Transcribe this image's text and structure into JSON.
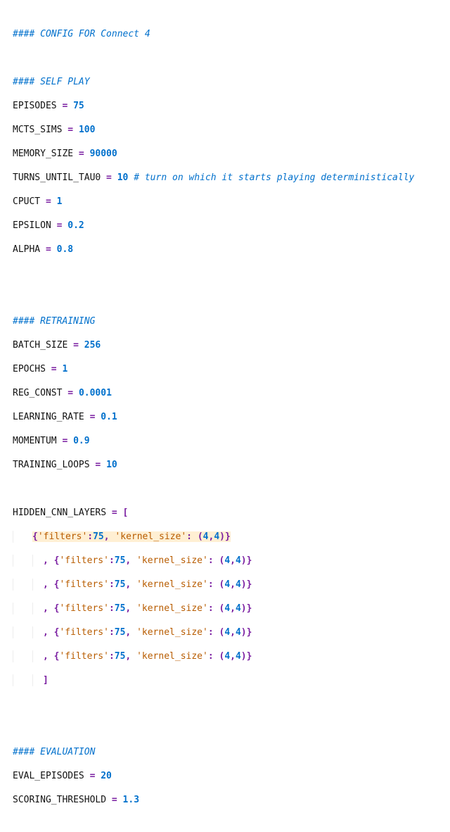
{
  "title_comment": "#### CONFIG FOR Connect 4",
  "self_play_comment": "#### SELF PLAY",
  "episodes_name": "EPISODES",
  "episodes_val": "75",
  "mcts_name": "MCTS_SIMS",
  "mcts_val": "100",
  "mem_name": "MEMORY_SIZE",
  "mem_val": "90000",
  "tau_name": "TURNS_UNTIL_TAU0",
  "tau_val": "10",
  "tau_comment": "# turn on which it starts playing deterministically",
  "cpuct_name": "CPUCT",
  "cpuct_val": "1",
  "eps_name": "EPSILON",
  "eps_val": "0.2",
  "alpha_name": "ALPHA",
  "alpha_val": "0.8",
  "retrain_comment": "#### RETRAINING",
  "batch_name": "BATCH_SIZE",
  "batch_val": "256",
  "epochs_name": "EPOCHS",
  "epochs_val": "1",
  "reg_name": "REG_CONST",
  "reg_val": "0.0001",
  "lr_name": "LEARNING_RATE",
  "lr_val": "0.1",
  "mom_name": "MOMENTUM",
  "mom_val": "0.9",
  "tl_name": "TRAINING_LOOPS",
  "tl_val": "10",
  "hcl_name": "HIDDEN_CNN_LAYERS",
  "filters_key": "'filters'",
  "filters_val": "75",
  "ks_key": "'kernel_size'",
  "ks_a": "4",
  "ks_b": "4",
  "eval_comment": "#### EVALUATION",
  "evep_name": "EVAL_EPISODES",
  "evep_val": "20",
  "sth_name": "SCORING_THRESHOLD",
  "sth_val": "1.3",
  "eq": " = ",
  "open_bracket": "[",
  "close_bracket": "]",
  "open_brace": "{",
  "close_brace": "}",
  "open_paren": "(",
  "close_paren": ")",
  "colon": ":",
  "comma": ","
}
